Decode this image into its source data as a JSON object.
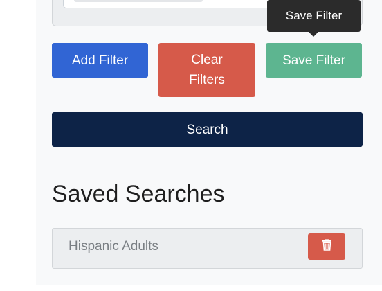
{
  "buttons": {
    "add_filter": "Add Filter",
    "clear_filters": "Clear Filters",
    "save_filter": "Save Filter",
    "search": "Search"
  },
  "tooltip": {
    "text": "Save Filter"
  },
  "saved_searches": {
    "title": "Saved Searches",
    "items": [
      {
        "label": "Hispanic Adults",
        "delete_icon": "trash-icon"
      }
    ]
  },
  "colors": {
    "add_filter": "#3165d4",
    "clear_filters": "#d65a4a",
    "save_filter": "#5db590",
    "search": "#0d2347",
    "delete": "#d65a4a",
    "tooltip": "#2b2b2b"
  }
}
